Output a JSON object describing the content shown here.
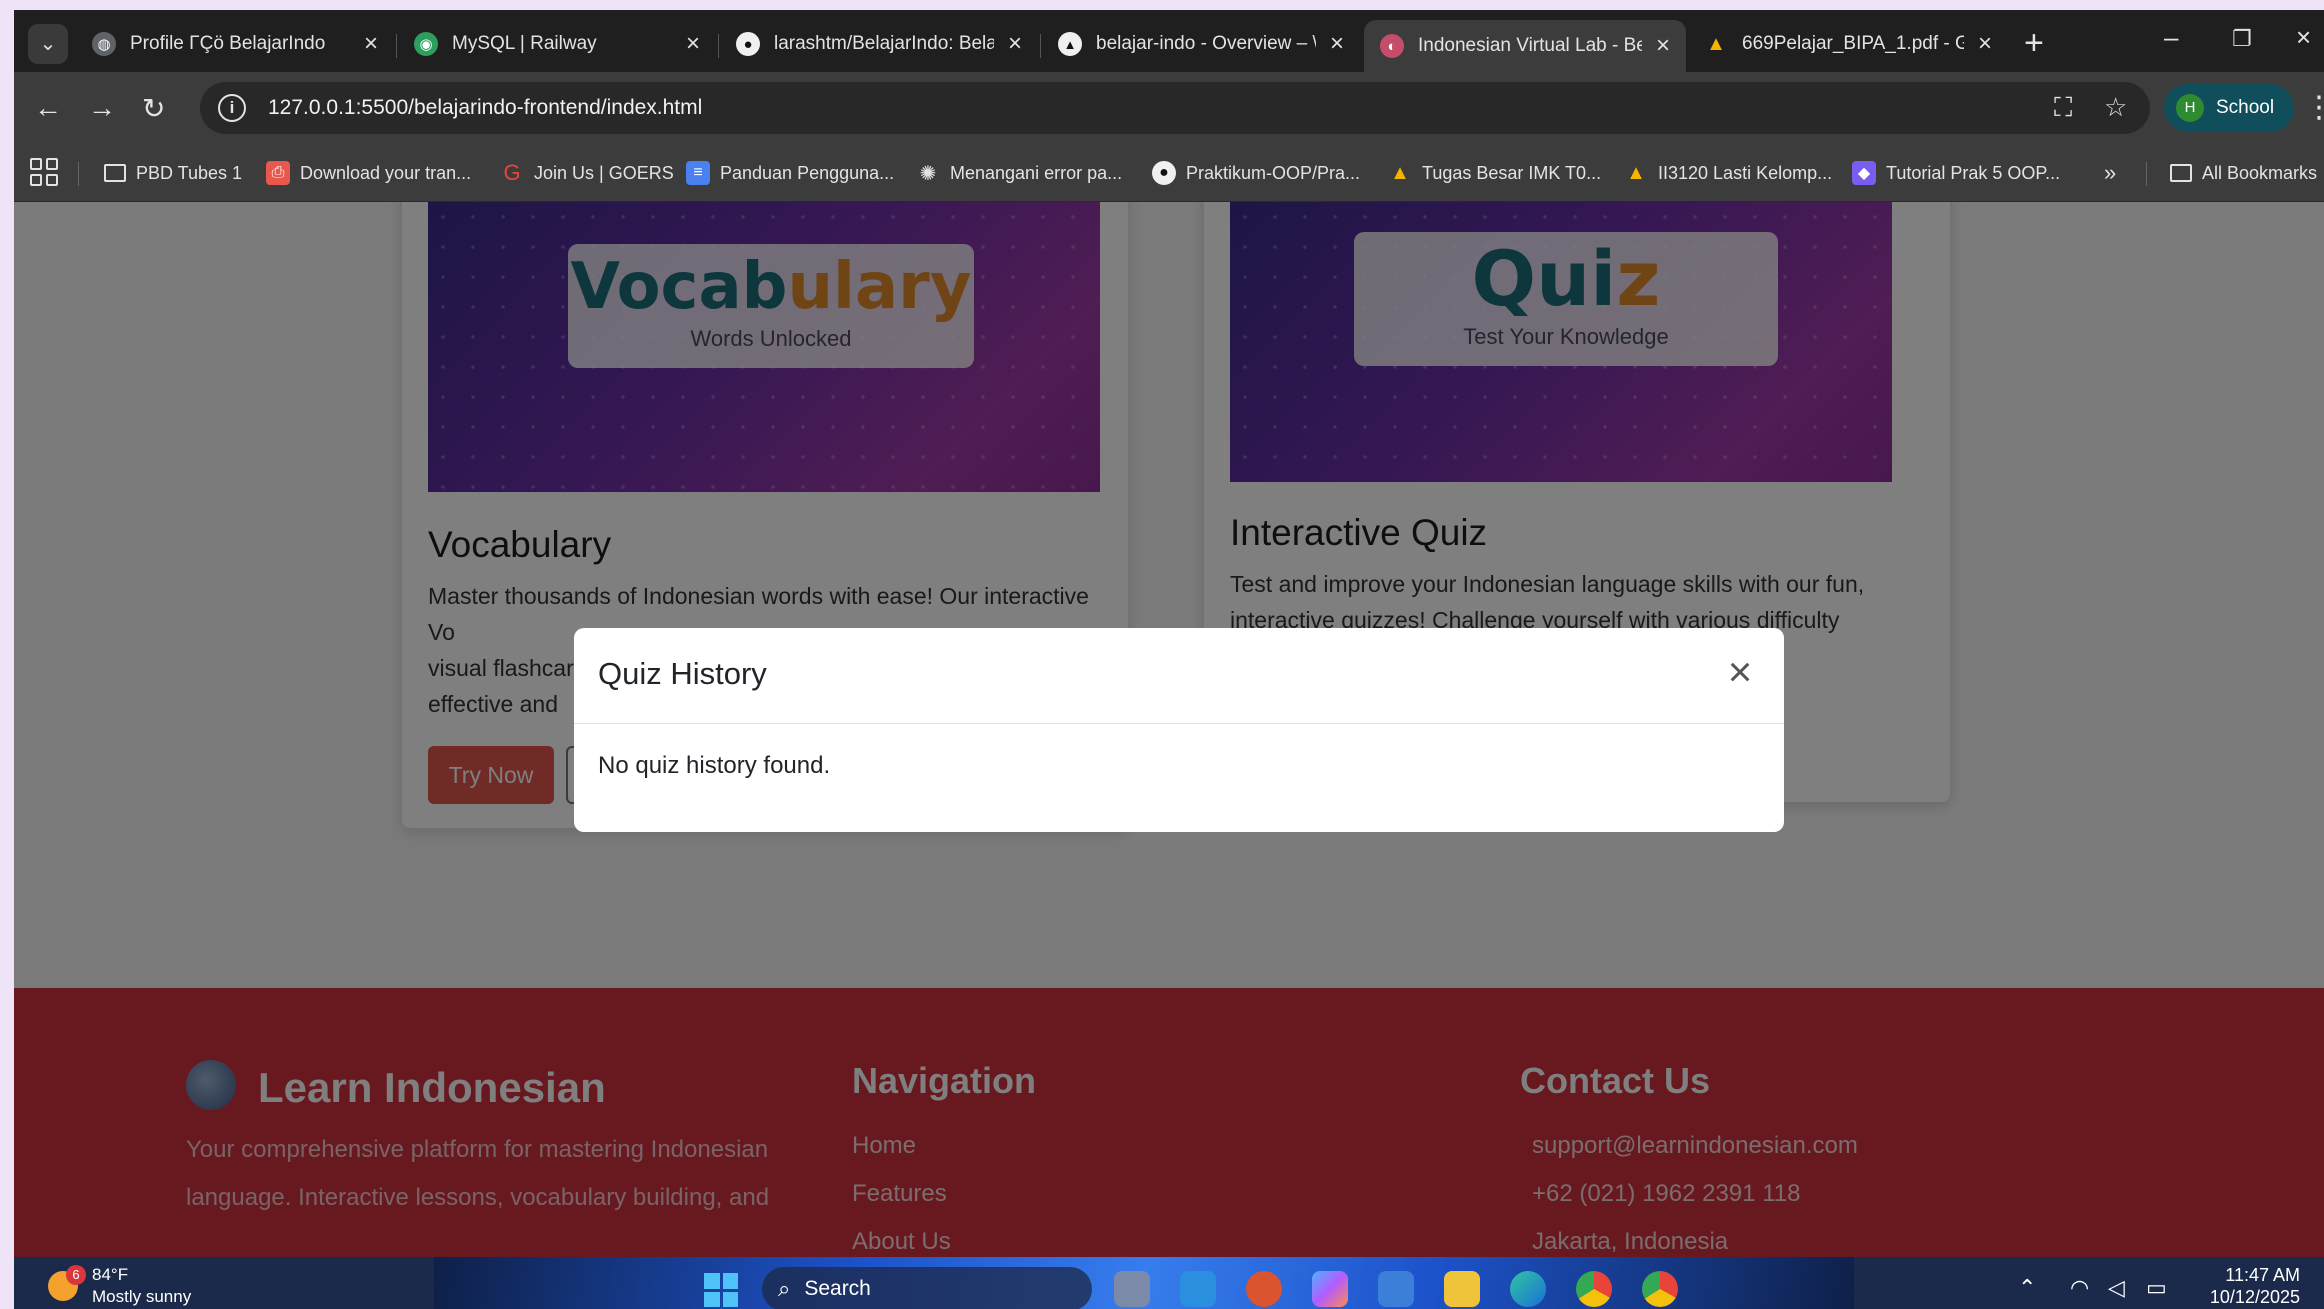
{
  "browser": {
    "tabs": [
      {
        "title": "Profile ΓÇö BelajarIndo",
        "favicon": "globe-icon",
        "active": false
      },
      {
        "title": "MySQL | Railway",
        "favicon": "railway-icon",
        "active": false
      },
      {
        "title": "larashtm/BelajarIndo: Belaj",
        "favicon": "github-icon",
        "active": false
      },
      {
        "title": "belajar-indo - Overview – \\",
        "favicon": "vercel-icon",
        "active": false
      },
      {
        "title": "Indonesian Virtual Lab - Be",
        "favicon": "site-icon",
        "active": true
      },
      {
        "title": "669Pelajar_BIPA_1.pdf - Go",
        "favicon": "google-drive-icon",
        "active": false
      }
    ],
    "address": "127.0.0.1:5500/belajarindo-frontend/index.html",
    "profile": {
      "initial": "H",
      "label": "School"
    },
    "bookmarks": [
      {
        "label": "PBD Tubes 1",
        "icon": "folder-icon"
      },
      {
        "label": "Download your tran...",
        "icon": "pdf-icon"
      },
      {
        "label": "Join Us | GOERS",
        "icon": "goers-icon"
      },
      {
        "label": "Panduan Pengguna...",
        "icon": "docs-icon"
      },
      {
        "label": "Menangani error pa...",
        "icon": "openai-icon"
      },
      {
        "label": "Praktikum-OOP/Pra...",
        "icon": "github-icon"
      },
      {
        "label": "Tugas Besar IMK T0...",
        "icon": "google-drive-icon"
      },
      {
        "label": "II3120 Lasti Kelomp...",
        "icon": "google-drive-icon"
      },
      {
        "label": "Tutorial Prak 5 OOP...",
        "icon": "app-icon"
      }
    ],
    "more_bookmarks": "»",
    "all_bookmarks": "All Bookmarks"
  },
  "cards": {
    "vocab": {
      "img_word_a": "Vocab",
      "img_word_b": "ulary",
      "img_sub": "Words Unlocked",
      "title": "Vocabulary",
      "text": "Master thousands of Indonesian words with ease! Our interactive Vo",
      "text2": "visual flashcar",
      "text3": "effective and",
      "button": "Try Now"
    },
    "quiz": {
      "img_word_a": "Qui",
      "img_word_b": "z",
      "img_sub": "Test Your Knowledge",
      "title": "Interactive Quiz",
      "text": "Test and improve your Indonesian language skills with our fun, interactive quizzes! Challenge yourself with various difficulty"
    }
  },
  "footer": {
    "brand": "Learn Indonesian",
    "desc": "Your comprehensive platform for mastering Indonesian language. Interactive lessons, vocabulary building, and",
    "nav_head": "Navigation",
    "nav_links": [
      "Home",
      "Features",
      "About Us"
    ],
    "contact_head": "Contact Us",
    "contact": [
      "support@learnindonesian.com",
      "+62 (021) 1962 2391 118",
      "Jakarta, Indonesia"
    ]
  },
  "modal": {
    "title": "Quiz History",
    "close": "×",
    "message": "No quiz history found."
  },
  "taskbar": {
    "weather_badge": "6",
    "temp": "84°F",
    "desc": "Mostly sunny",
    "search": "Search",
    "time": "11:47 AM",
    "date": "10/12/2025"
  },
  "colors": {
    "accent": "#e2574c",
    "footer": "#d0323f",
    "profile_chip": "#0f4e5a"
  }
}
